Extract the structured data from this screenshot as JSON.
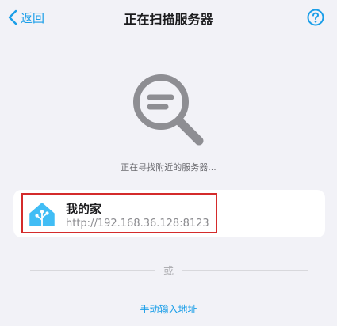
{
  "nav": {
    "back_label": "返回",
    "title": "正在扫描服务器",
    "help_icon": "question-circle-icon"
  },
  "scan": {
    "illustration_icon": "magnifier-icon",
    "status_text": "正在寻找附近的服务器..."
  },
  "servers": [
    {
      "name": "我的家",
      "url": "http://192.168.36.128:8123",
      "icon": "home-assistant-logo-icon"
    }
  ],
  "divider_label": "或",
  "manual_entry_label": "手动输入地址",
  "colors": {
    "accent": "#1a9ee8",
    "background": "#f2f2f7",
    "highlight_border": "#d42b2b",
    "illustration_gray": "#8e8e93",
    "ha_logo": "#41bdf5"
  }
}
